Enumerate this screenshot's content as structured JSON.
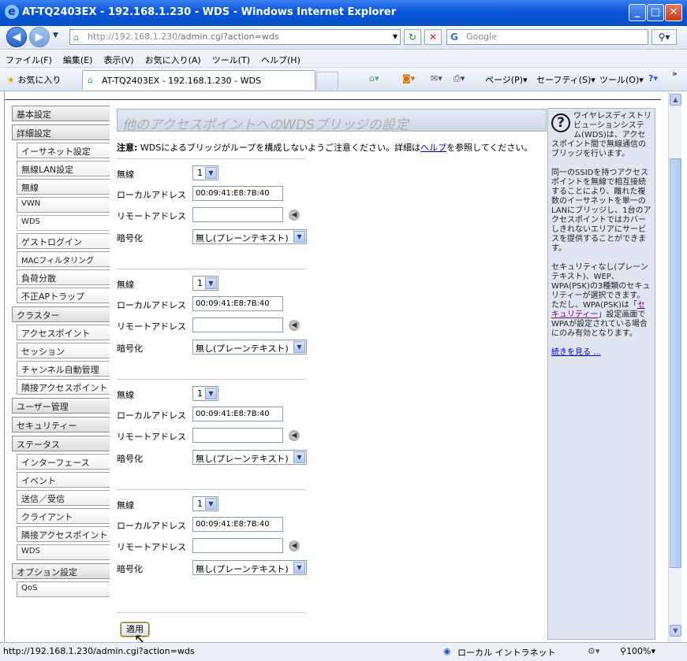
{
  "window": {
    "title": "AT-TQ2403EX - 192.168.1.230 - WDS - Windows Internet Explorer",
    "min": "_",
    "max": "□",
    "close": "✕"
  },
  "address": {
    "url_host": "http://192.168.1.230/",
    "url_path": "admin.cgi?action=wds",
    "search_placeholder": "Google"
  },
  "menu": [
    "ファイル(F)",
    "編集(E)",
    "表示(V)",
    "お気に入り(A)",
    "ツール(T)",
    "ヘルプ(H)"
  ],
  "favbar": {
    "favorites": "お気に入り",
    "tab_title": "AT-TQ2403EX - 192.168.1.230 - WDS",
    "page": "ページ(P)",
    "safety": "セーフティ(S)",
    "tools": "ツール(O)",
    "more": "»"
  },
  "sidebar": [
    {
      "type": "group",
      "label": "基本設定"
    },
    {
      "type": "group",
      "label": "詳細設定"
    },
    {
      "type": "item",
      "label": "イーサネット設定"
    },
    {
      "type": "item",
      "label": "無線LAN設定"
    },
    {
      "type": "item",
      "label": "無線"
    },
    {
      "type": "item",
      "label": "VWN",
      "small": true
    },
    {
      "type": "item",
      "label": "WDS",
      "selected": true
    },
    {
      "type": "item",
      "label": "ゲストログイン"
    },
    {
      "type": "item",
      "label": "MACフィルタリング",
      "small": true
    },
    {
      "type": "item",
      "label": "負荷分散"
    },
    {
      "type": "item",
      "label": "不正APトラップ"
    },
    {
      "type": "group",
      "label": "クラスター"
    },
    {
      "type": "item",
      "label": "アクセスポイント"
    },
    {
      "type": "item",
      "label": "セッション"
    },
    {
      "type": "item",
      "label": "チャンネル自動管理"
    },
    {
      "type": "item",
      "label": "隣接アクセスポイント"
    },
    {
      "type": "group",
      "label": "ユーザー管理"
    },
    {
      "type": "group",
      "label": "セキュリティー"
    },
    {
      "type": "group",
      "label": "ステータス"
    },
    {
      "type": "item",
      "label": "インターフェース"
    },
    {
      "type": "item",
      "label": "イベント"
    },
    {
      "type": "item",
      "label": "送信／受信"
    },
    {
      "type": "item",
      "label": "クライアント"
    },
    {
      "type": "item",
      "label": "隣接アクセスポイント"
    },
    {
      "type": "item",
      "label": "WDS",
      "small": true
    },
    {
      "type": "group",
      "label": "オプション設定"
    },
    {
      "type": "item",
      "label": "QoS",
      "small": true
    }
  ],
  "main": {
    "title": "他のアクセスポイントへのWDSブリッジの設定",
    "note_label": "注意:",
    "note_text": " WDSによるブリッジがループを構成しないようご注意ください。詳細は",
    "note_link": "ヘルプ",
    "note_tail": "を参照してください。",
    "labels": {
      "radio": "無線",
      "local": "ローカルアドレス",
      "remote": "リモートアドレス",
      "enc": "暗号化"
    },
    "bridges": [
      {
        "radio": "1",
        "local": "00:09:41:E8:7B:40",
        "remote": "",
        "enc": "無し(プレーンテキスト)"
      },
      {
        "radio": "1",
        "local": "00:09:41:E8:7B:40",
        "remote": "",
        "enc": "無し(プレーンテキスト)"
      },
      {
        "radio": "1",
        "local": "00:09:41:E8:7B:40",
        "remote": "",
        "enc": "無し(プレーンテキスト)"
      },
      {
        "radio": "1",
        "local": "00:09:41:E8:7B:40",
        "remote": "",
        "enc": "無し(プレーンテキスト)"
      }
    ],
    "apply": "適用"
  },
  "help": {
    "p1": "ワイヤレスディストリビューションシステム(WDS)は、アクセスポイント間で無線通信のブリッジを行います。",
    "p2": "同一のSSIDを持つアクセスポイントを無線で相互接続することにより、離れた複数のイーサネットを単一のLANにブリッジし、1台のアクセスポイントではカバーしきれないエリアにサービスを提供することができます。",
    "p3a": "セキュリティなし(プレーンテキスト)、WEP、WPA(PSK)の3種類のセキュリティーが選択できます。ただし、WPA(PSK)は「",
    "p3link": "セキュリティー",
    "p3b": "」設定画面でWPAが設定されている場合にのみ有効となります。",
    "more": "続きを見る ..."
  },
  "status": {
    "url": "http://192.168.1.230/admin.cgi?action=wds",
    "zone": "ローカル イントラネット",
    "zoom": "100%"
  }
}
